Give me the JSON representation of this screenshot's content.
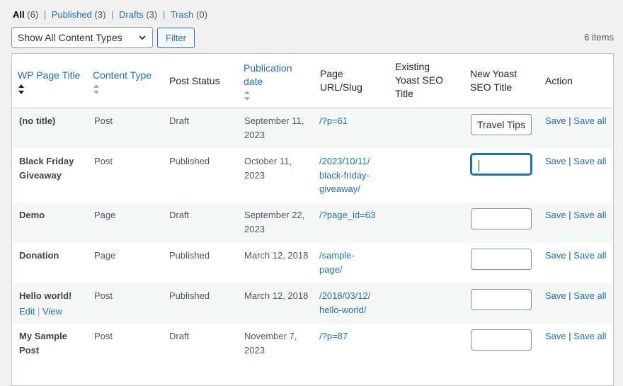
{
  "views": [
    {
      "label": "All",
      "count": "(6)"
    },
    {
      "label": "Published",
      "count": "(3)"
    },
    {
      "label": "Drafts",
      "count": "(3)"
    },
    {
      "label": "Trash",
      "count": "(0)"
    }
  ],
  "separator": "|",
  "filter": {
    "select_value": "Show All Content Types",
    "button_label": "Filter",
    "items_count": "6 items"
  },
  "columns": {
    "title": "WP Page Title",
    "content_type": "Content Type",
    "status": "Post Status",
    "pub_date": "Publication date",
    "url": "Page URL/Slug",
    "existing_seo": "Existing Yoast SEO Title",
    "new_seo": "New Yoast SEO Title",
    "action": "Action"
  },
  "action_labels": {
    "save": "Save",
    "save_all": "Save all",
    "sep": "|"
  },
  "row_action_labels": {
    "edit": "Edit",
    "view": "View",
    "sep": "|"
  },
  "rows": [
    {
      "title": "(no title)",
      "type": "Post",
      "status": "Draft",
      "date": "September 11, 2023",
      "url": "/?p=61",
      "existing": "",
      "new_seo": "Travel Tips"
    },
    {
      "title": "Black Friday Giveaway",
      "type": "Post",
      "status": "Published",
      "date": "October 11, 2023",
      "url": "/2023/10/11/black-friday-giveaway/",
      "existing": "",
      "new_seo": ""
    },
    {
      "title": "Demo",
      "type": "Page",
      "status": "Draft",
      "date": "September 22, 2023",
      "url": "/?page_id=63",
      "existing": "",
      "new_seo": ""
    },
    {
      "title": "Donation",
      "type": "Page",
      "status": "Published",
      "date": "March 12, 2018",
      "url": "/sample-page/",
      "existing": "",
      "new_seo": ""
    },
    {
      "title": "Hello world!",
      "type": "Post",
      "status": "Published",
      "date": "March 12, 2018",
      "url": "/2018/03/12/hello-world/",
      "existing": "",
      "new_seo": ""
    },
    {
      "title": "My Sample Post",
      "type": "Post",
      "status": "Draft",
      "date": "November 7, 2023",
      "url": "/?p=87",
      "existing": "",
      "new_seo": ""
    }
  ]
}
